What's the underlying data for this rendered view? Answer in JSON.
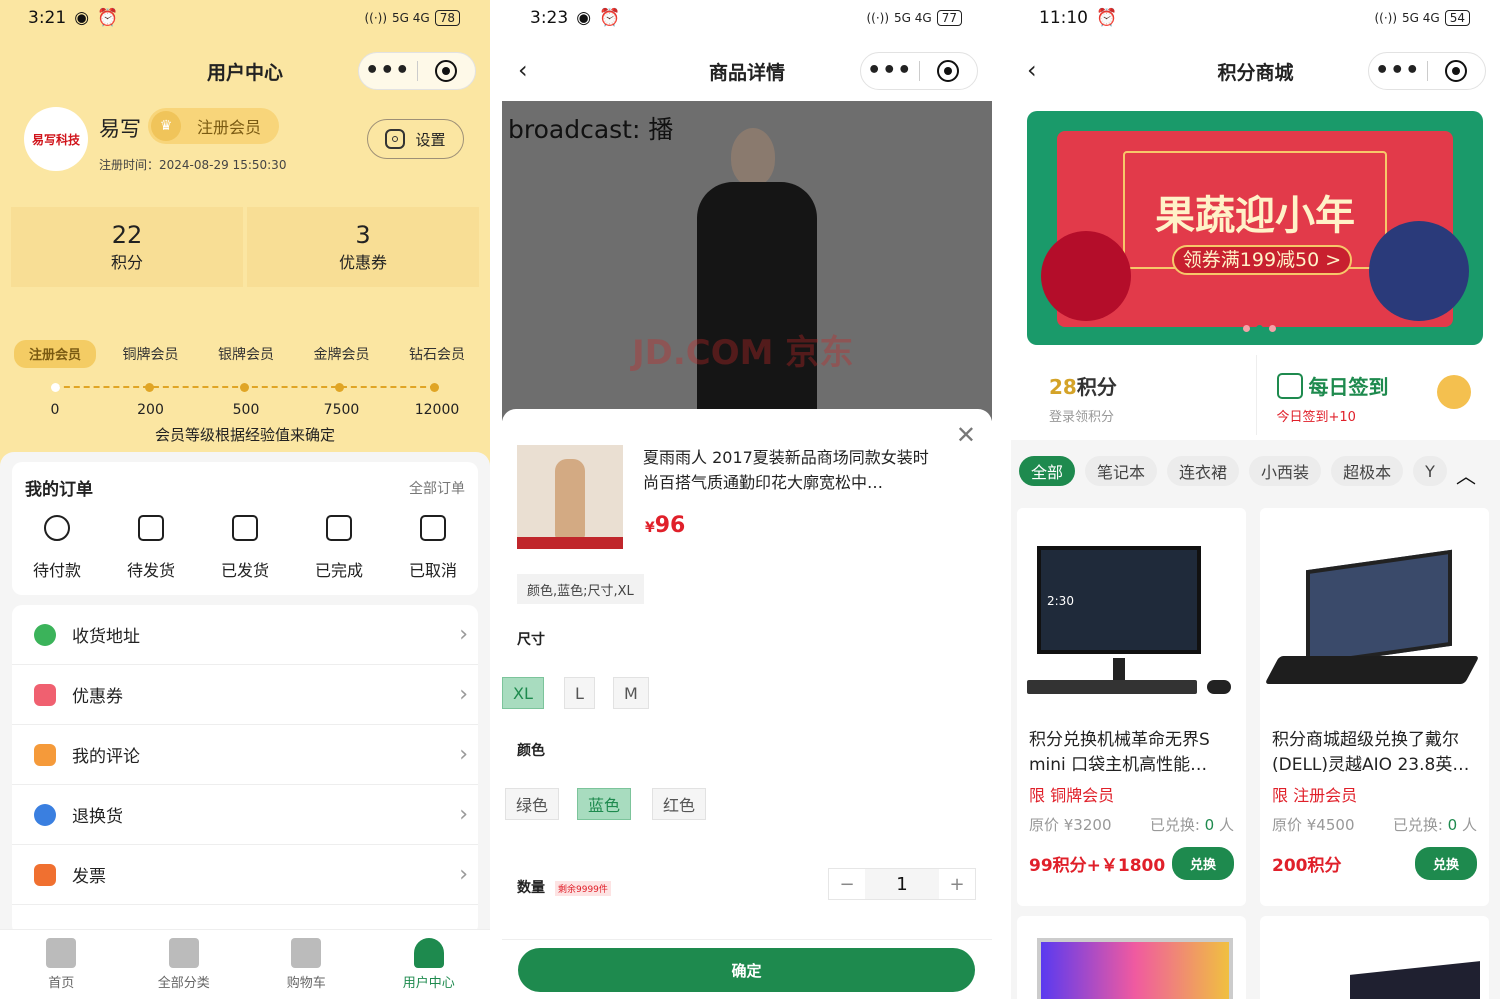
{
  "screen1": {
    "status": {
      "time": "3:21",
      "battery": "78",
      "net": "5G 4G"
    },
    "title": "用户中心",
    "avatar_text": "易写科技",
    "username": "易写",
    "member_badge": "注册会员",
    "reg_time": "注册时间：2024-08-29 15:50:30",
    "settings_label": "设置",
    "stats": [
      {
        "value": "22",
        "label": "积分"
      },
      {
        "value": "3",
        "label": "优惠券"
      }
    ],
    "levels": [
      "注册会员",
      "铜牌会员",
      "银牌会员",
      "金牌会员",
      "钻石会员"
    ],
    "level_values": [
      "0",
      "200",
      "500",
      "7500",
      "12000"
    ],
    "level_note": "会员等级根据经验值来确定",
    "orders": {
      "title": "我的订单",
      "all": "全部订单",
      "items": [
        "待付款",
        "待发货",
        "已发货",
        "已完成",
        "已取消"
      ]
    },
    "menu": [
      {
        "label": "收货地址",
        "color": "#3bb35a"
      },
      {
        "label": "优惠券",
        "color": "#f06070"
      },
      {
        "label": "我的评论",
        "color": "#f59a3a"
      },
      {
        "label": "退换货",
        "color": "#3a7fe0"
      },
      {
        "label": "发票",
        "color": "#f07030"
      }
    ],
    "tabs": [
      "首页",
      "全部分类",
      "购物车",
      "用户中心"
    ]
  },
  "screen2": {
    "status": {
      "time": "3:23",
      "battery": "77",
      "net": "5G 4G"
    },
    "title": "商品详情",
    "brand": "broadcast: 播",
    "watermark": "JD.COM 京东",
    "product_name": "夏雨雨人 2017夏装新品商场同款女装时尚百搭气质通勤印花大廓宽松中…",
    "currency": "¥",
    "price": "96",
    "selected_summary": "颜色,蓝色;尺寸,XL",
    "size_label": "尺寸",
    "sizes": [
      "XL",
      "L",
      "M"
    ],
    "color_label": "颜色",
    "colors": [
      "绿色",
      "蓝色",
      "红色"
    ],
    "qty_label": "数量",
    "stock": "剩余9999件",
    "minus": "−",
    "qty": "1",
    "plus": "+",
    "confirm": "确定"
  },
  "screen3": {
    "status": {
      "time": "11:10",
      "battery": "54",
      "net": "5G 4G"
    },
    "title": "积分商城",
    "banner_title": "果蔬迎小年",
    "banner_sub": "领券满199减50 >",
    "points_num": "28",
    "points_unit": "积分",
    "points_sub": "登录领积分",
    "signin_title": "每日签到",
    "signin_sub": "今日签到+10",
    "categories": [
      "全部",
      "笔记本",
      "连衣裙",
      "小西装",
      "超极本",
      "Y"
    ],
    "goods": [
      {
        "name": "积分兑换机械革命无界S mini 口袋主机高性能…",
        "limit": "限 铜牌会员",
        "orig": "原价 ¥3200",
        "swapped": "已兑换: ",
        "count": "0",
        "unit": " 人",
        "price": "99积分+￥1800",
        "btn": "兑换"
      },
      {
        "name": "积分商城超级兑换了戴尔(DELL)灵越AIO 23.8英…",
        "limit": "限 注册会员",
        "orig": "原价 ¥4500",
        "swapped": "已兑换: ",
        "count": "0",
        "unit": " 人",
        "price": "200积分",
        "btn": "兑换"
      }
    ],
    "screen_clock": "2:30"
  },
  "colors": {
    "brand_green": "#1e8a4e",
    "price_red": "#e0202a",
    "member_yellow": "#fbe6a2"
  }
}
